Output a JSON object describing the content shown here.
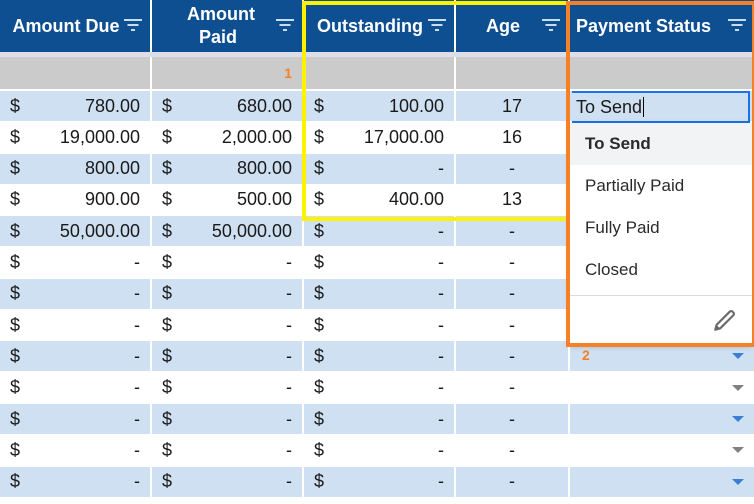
{
  "columns": [
    {
      "label": "Amount Due",
      "filter_icon": "filter-icon"
    },
    {
      "label": "Amount Paid",
      "filter_icon": "filter-icon"
    },
    {
      "label": "Outstanding",
      "filter_icon": "filter-icon"
    },
    {
      "label": "Age",
      "filter_icon": "filter-icon"
    },
    {
      "label": "Payment Status",
      "filter_icon": "filter-icon"
    }
  ],
  "markers": {
    "one": "1",
    "two": "2"
  },
  "currency_symbol": "$",
  "rows": [
    {
      "due": "780.00",
      "paid": "680.00",
      "outstanding": "100.00",
      "age": "17",
      "status": ""
    },
    {
      "due": "19,000.00",
      "paid": "2,000.00",
      "outstanding": "17,000.00",
      "age": "16",
      "status": ""
    },
    {
      "due": "800.00",
      "paid": "800.00",
      "outstanding": "-",
      "age": "-",
      "status": ""
    },
    {
      "due": "900.00",
      "paid": "500.00",
      "outstanding": "400.00",
      "age": "13",
      "status": ""
    },
    {
      "due": "50,000.00",
      "paid": "50,000.00",
      "outstanding": "-",
      "age": "-",
      "status": ""
    },
    {
      "due": "-",
      "paid": "-",
      "outstanding": "-",
      "age": "-",
      "status": ""
    },
    {
      "due": "-",
      "paid": "-",
      "outstanding": "-",
      "age": "-",
      "status": ""
    },
    {
      "due": "-",
      "paid": "-",
      "outstanding": "-",
      "age": "-",
      "status": ""
    },
    {
      "due": "-",
      "paid": "-",
      "outstanding": "-",
      "age": "-",
      "status": ""
    },
    {
      "due": "-",
      "paid": "-",
      "outstanding": "-",
      "age": "-",
      "status": ""
    },
    {
      "due": "-",
      "paid": "-",
      "outstanding": "-",
      "age": "-",
      "status": ""
    },
    {
      "due": "-",
      "paid": "-",
      "outstanding": "-",
      "age": "-",
      "status": ""
    },
    {
      "due": "-",
      "paid": "-",
      "outstanding": "-",
      "age": "-",
      "status": ""
    }
  ],
  "status_editor": {
    "value": "To Send",
    "options": [
      "To Send",
      "Partially Paid",
      "Fully Paid",
      "Closed"
    ],
    "highlighted_option": "To Send",
    "edit_icon": "pencil-icon"
  },
  "colors": {
    "header_bg": "#0d4f91",
    "row_shade": "#cfe0f2",
    "highlight_yellow": "#fff200",
    "highlight_orange": "#f58026",
    "marker": "#f58026"
  }
}
